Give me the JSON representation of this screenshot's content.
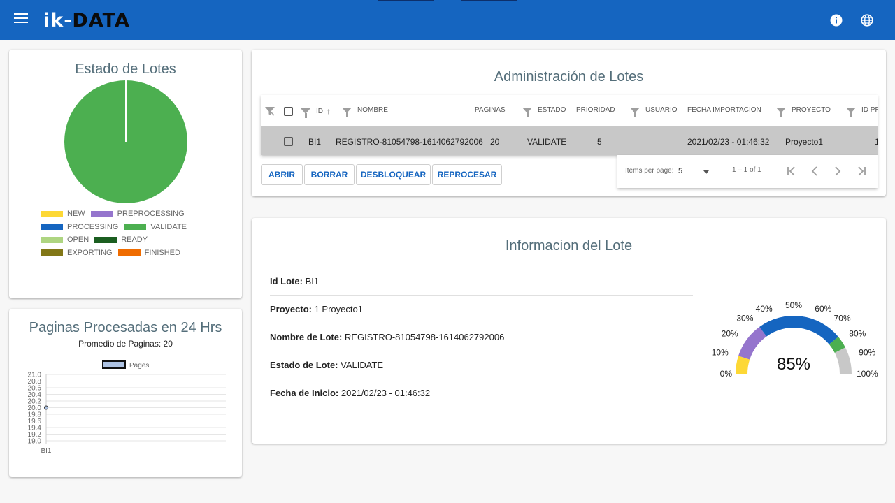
{
  "header": {
    "logo_prefix": "ik-",
    "logo_suffix": "DATA"
  },
  "estado_lotes": {
    "title": "Estado de Lotes",
    "chart_data": {
      "type": "pie",
      "title": "Estado de Lotes",
      "categories": [
        "NEW",
        "PREPROCESSING",
        "PROCESSING",
        "VALIDATE",
        "OPEN",
        "READY",
        "EXPORTING",
        "FINISHED"
      ],
      "values": [
        0,
        0,
        0,
        1,
        0,
        0,
        0,
        0
      ],
      "colors": [
        "#fdd835",
        "#9575cd",
        "#1565c0",
        "#4caf50",
        "#aed581",
        "#1b5e20",
        "#827717",
        "#ef6c00"
      ],
      "legend": "bottom"
    }
  },
  "paginas": {
    "title": "Paginas Procesadas en 24 Hrs",
    "average_text": "Promedio de Paginas: 20",
    "chart_data": {
      "type": "line",
      "categories": [
        "BI1"
      ],
      "series": [
        {
          "name": "Pages",
          "values": [
            20
          ]
        }
      ],
      "ylim": [
        19.0,
        21.0
      ],
      "yticks": [
        "21.0",
        "20.8",
        "20.6",
        "20.4",
        "20.2",
        "20.0",
        "19.8",
        "19.6",
        "19.4",
        "19.2",
        "19.0"
      ],
      "grid": true,
      "legend": "top"
    }
  },
  "admin": {
    "title": "Administración de Lotes",
    "columns": [
      "ID",
      "NOMBRE",
      "PAGINAS",
      "ESTADO",
      "PRIORIDAD",
      "USUARIO",
      "FECHA IMPORTACION",
      "PROYECTO",
      "ID PR"
    ],
    "row": {
      "id": "BI1",
      "nombre": "REGISTRO-81054798-1614062792006",
      "paginas": "20",
      "estado": "VALIDATE",
      "prioridad": "5",
      "usuario": "",
      "fecha": "2021/02/23 - 01:46:32",
      "proyecto": "Proyecto1",
      "id_pr": "1"
    },
    "buttons": [
      "ABRIR",
      "BORRAR",
      "DESBLOQUEAR",
      "REPROCESAR"
    ],
    "paginator": {
      "items_label": "Items per page:",
      "page_size": "5",
      "range": "1 – 1 of 1"
    }
  },
  "info": {
    "title": "Informacion del Lote",
    "fields": [
      {
        "label": "Id Lote:",
        "value": "BI1"
      },
      {
        "label": "Proyecto:",
        "value": "1 Proyecto1"
      },
      {
        "label": "Nombre de Lote:",
        "value": "REGISTRO-81054798-1614062792006"
      },
      {
        "label": "Estado de Lote:",
        "value": "VALIDATE"
      },
      {
        "label": "Fecha de Inicio:",
        "value": "2021/02/23 - 01:46:32"
      }
    ],
    "gauge": {
      "value_text": "85%",
      "value": 85,
      "tick_labels": [
        "0%",
        "10%",
        "20%",
        "30%",
        "40%",
        "50%",
        "60%",
        "70%",
        "80%",
        "90%",
        "100%"
      ],
      "segments": [
        {
          "from": 0,
          "to": 10,
          "color": "#fdd835"
        },
        {
          "from": 10,
          "to": 30,
          "color": "#9575cd"
        },
        {
          "from": 30,
          "to": 78,
          "color": "#1565c0"
        },
        {
          "from": 78,
          "to": 85,
          "color": "#4caf50"
        },
        {
          "from": 85,
          "to": 100,
          "color": "#c8c8c8"
        }
      ]
    }
  }
}
